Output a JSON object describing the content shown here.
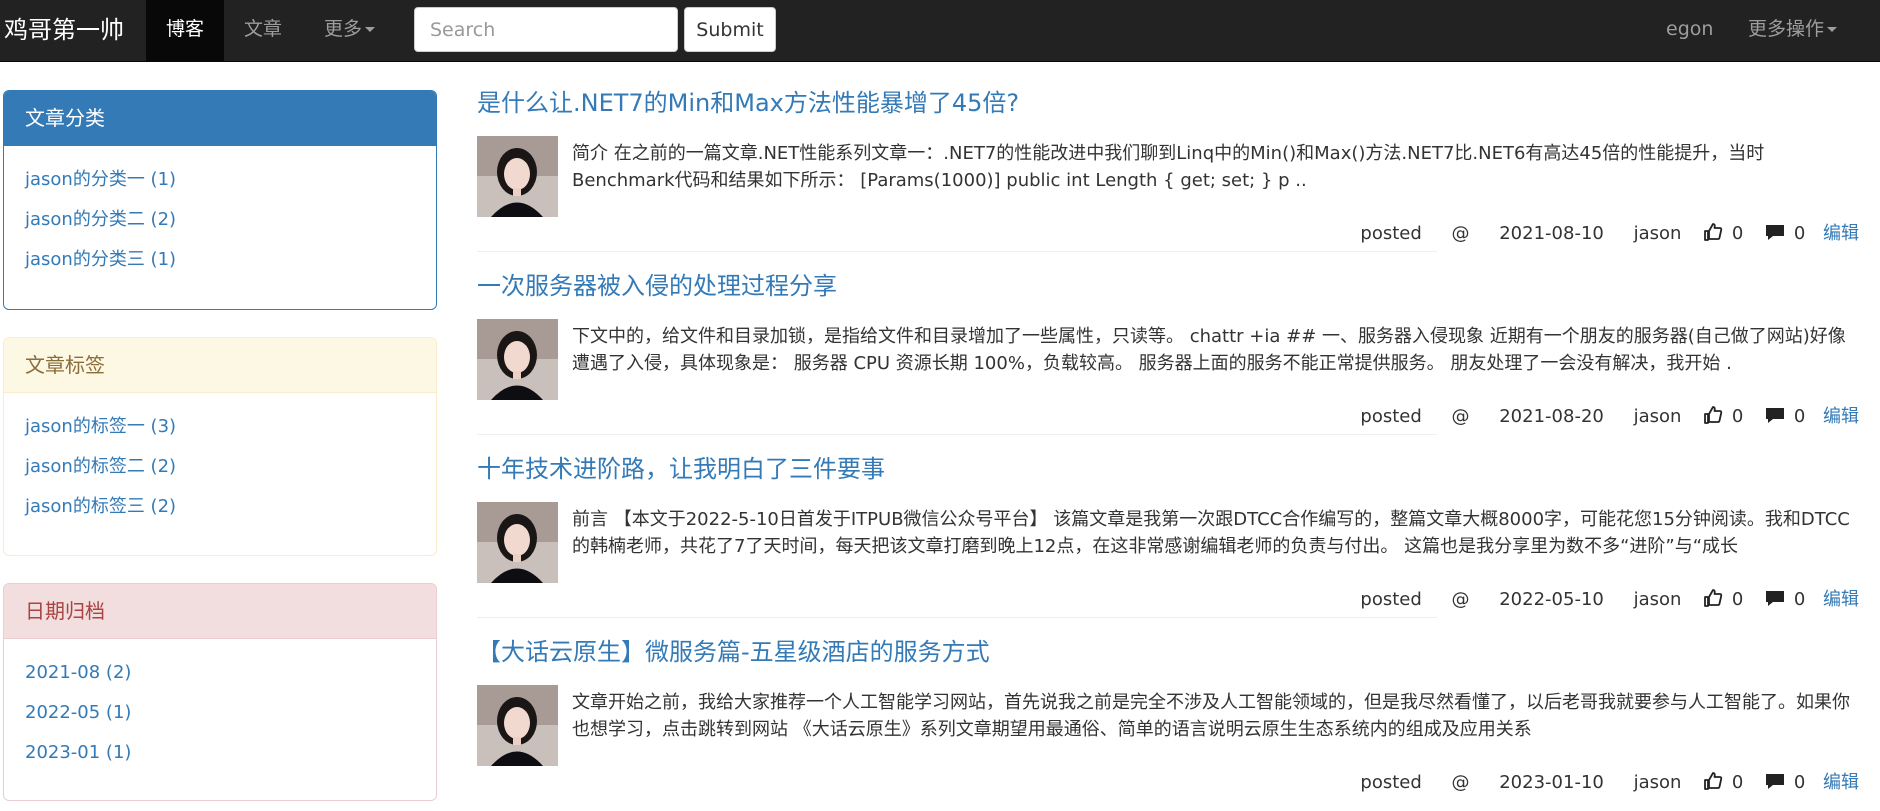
{
  "navbar": {
    "brand": "鸡哥第一帅",
    "items": [
      {
        "label": "博客",
        "active": true
      },
      {
        "label": "文章",
        "active": false
      },
      {
        "label": "更多",
        "active": false
      }
    ],
    "search_placeholder": "Search",
    "submit_label": "Submit",
    "user": "egon",
    "more_actions": "更多操作"
  },
  "sidebar": {
    "categories": {
      "title": "文章分类",
      "items": [
        "jason的分类一 (1)",
        "jason的分类二 (2)",
        "jason的分类三 (1)"
      ]
    },
    "tags": {
      "title": "文章标签",
      "items": [
        "jason的标签一 (3)",
        "jason的标签二 (2)",
        "jason的标签三 (2)"
      ]
    },
    "archives": {
      "title": "日期归档",
      "items": [
        "2021-08 (2)",
        "2022-05 (1)",
        "2023-01 (1)"
      ]
    }
  },
  "articles": [
    {
      "title": "是什么让.NET7的Min和Max方法性能暴增了45倍?",
      "summary": "简介 在之前的一篇文章.NET性能系列文章一：.NET7的性能改进中我们聊到Linq中的Min()和Max()方法.NET7比.NET6有高达45倍的性能提升，当时Benchmark代码和结果如下所示： [Params(1000)] public int Length { get; set; } p ..",
      "posted": "posted",
      "at": "@",
      "date": "2021-08-10",
      "author": "jason",
      "likes": "0",
      "comments": "0",
      "edit": "编辑"
    },
    {
      "title": "一次服务器被入侵的处理过程分享",
      "summary": "下文中的，给文件和目录加锁，是指给文件和目录增加了一些属性，只读等。 chattr +ia ## 一、服务器入侵现象 近期有一个朋友的服务器(自己做了网站)好像遭遇了入侵，具体现象是： 服务器 CPU 资源长期 100%，负载较高。 服务器上面的服务不能正常提供服务。 朋友处理了一会没有解决，我开始 .",
      "posted": "posted",
      "at": "@",
      "date": "2021-08-20",
      "author": "jason",
      "likes": "0",
      "comments": "0",
      "edit": "编辑"
    },
    {
      "title": "十年技术进阶路，让我明白了三件要事",
      "summary": "前言 【本文于2022-5-10日首发于ITPUB微信公众号平台】 该篇文章是我第一次跟DTCC合作编写的，整篇文章大概8000字，可能花您15分钟阅读。我和DTCC的韩楠老师，共花了7了天时间，每天把该文章打磨到晚上12点，在这非常感谢编辑老师的负责与付出。 这篇也是我分享里为数不多“进阶”与“成长",
      "posted": "posted",
      "at": "@",
      "date": "2022-05-10",
      "author": "jason",
      "likes": "0",
      "comments": "0",
      "edit": "编辑"
    },
    {
      "title": "【大话云原生】微服务篇-五星级酒店的服务方式",
      "summary": "文章开始之前，我给大家推荐一个人工智能学习网站，首先说我之前是完全不涉及人工智能领域的，但是我尽然看懂了，以后老哥我就要参与人工智能了。如果你也想学习，点击跳转到网站 《大话云原生》系列文章期望用最通俗、简单的语言说明云原生生态系统内的组成及应用关系",
      "posted": "posted",
      "at": "@",
      "date": "2023-01-10",
      "author": "jason",
      "likes": "0",
      "comments": "0",
      "edit": "编辑"
    }
  ]
}
